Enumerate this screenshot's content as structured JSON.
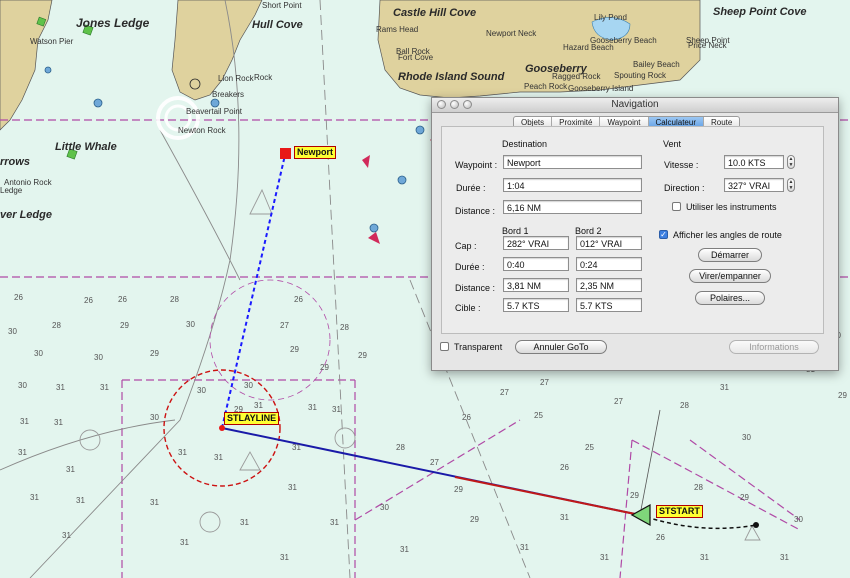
{
  "window": {
    "title": "Navigation",
    "tabs": [
      "Objets",
      "Proximité",
      "Waypoint",
      "Calculateur",
      "Route"
    ],
    "active_tab": "Calculateur"
  },
  "calculator": {
    "destination_header": "Destination",
    "waypoint_label": "Waypoint :",
    "waypoint_value": "Newport",
    "duration_label": "Durée :",
    "duration_value": "1:04",
    "distance_label": "Distance :",
    "distance_value": "6,16 NM",
    "bord1_header": "Bord 1",
    "bord2_header": "Bord 2",
    "cap_label": "Cap :",
    "cap_bord1": "282° VRAI",
    "cap_bord2": "012° VRAI",
    "duree_label": "Durée :",
    "duree_bord1": "0:40",
    "duree_bord2": "0:24",
    "dist_label": "Distance :",
    "dist_bord1": "3,81 NM",
    "dist_bord2": "2,35 NM",
    "cible_label": "Cible :",
    "cible_bord1": "5.7 KTS",
    "cible_bord2": "5.7 KTS",
    "vent_header": "Vent",
    "vitesse_label": "Vitesse :",
    "vitesse_value": "10.0 KTS",
    "direction_label": "Direction :",
    "direction_value": "327° VRAI",
    "utiliser_label": "Utiliser les instruments",
    "afficher_label": "Afficher les angles de route",
    "demarrer_label": "Démarrer",
    "virer_label": "Virer/empanner",
    "polaires_label": "Polaires...",
    "transparent_label": "Transparent",
    "annuler_label": "Annuler GoTo",
    "informations_label": "Informations"
  },
  "chart": {
    "places": [
      "Jones Ledge",
      "Hull Cove",
      "Castle Hill Cove",
      "Sheep Point Cove",
      "Rhode Island Sound",
      "Gooseberry",
      "Little Whale",
      "rrows",
      "ver Ledge",
      "Newport Neck",
      "Lily Pond",
      "Gooseberry Beach",
      "Hazard Beach",
      "Bailey Beach",
      "Spouting Rock",
      "Sheep Point",
      "Price Neck",
      "Rams Head",
      "Fort Cove",
      "Ball Rock",
      "Watson Pier",
      "Short Point",
      "Lion Rock",
      "Beavertail Point",
      "Newton Rock",
      "Breakers",
      "Antonio Rock",
      "Peach Rock",
      "Ledge",
      "Gooseberry Island",
      "Ragged Rock",
      "Rock"
    ],
    "waypoints": {
      "newport": "Newport",
      "stlayline": "STLAYLINE",
      "ststart": "STSTART"
    },
    "depths": [
      "26",
      "26",
      "26",
      "28",
      "28",
      "29",
      "29",
      "30",
      "30",
      "30",
      "30",
      "30",
      "31",
      "31",
      "31",
      "31",
      "31",
      "31",
      "31",
      "31",
      "31",
      "30",
      "30",
      "31",
      "31",
      "31",
      "29",
      "28",
      "27",
      "27",
      "26",
      "28",
      "29",
      "29",
      "29",
      "31",
      "31",
      "31",
      "30",
      "31",
      "31",
      "31",
      "31",
      "31",
      "31",
      "30",
      "31",
      "29",
      "29",
      "26",
      "25",
      "25",
      "29",
      "27",
      "26",
      "28",
      "29",
      "30",
      "31",
      "31",
      "31",
      "31",
      "31",
      "30",
      "31",
      "29",
      "31",
      "28",
      "27",
      "27",
      "26",
      "30"
    ],
    "colors": {
      "water": "#e3f5ee",
      "land": "#dfd29e",
      "route_blue": "#1a1aa8",
      "route_red": "#c01818",
      "zone_magenta": "#b04aa6"
    }
  }
}
